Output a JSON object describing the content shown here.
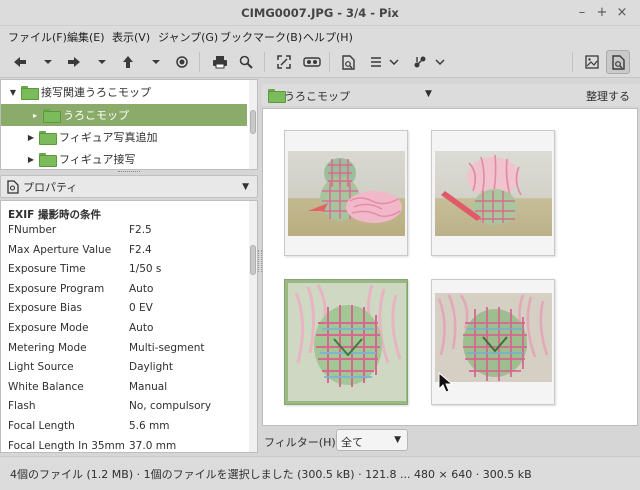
{
  "window": {
    "title": "CIMG0007.JPG - 3/4 - Pix",
    "minimize": "–",
    "maximize": "+",
    "close": "×"
  },
  "menu": [
    "ファイル(F)",
    "編集(E)",
    "表示(V)",
    "ジャンプ(G)",
    "ブックマーク(B)",
    "ヘルプ(H)"
  ],
  "tree": {
    "items": [
      {
        "label": "接写関連うろこモップ",
        "expanded": true
      },
      {
        "label": "うろこモップ",
        "selected": true
      },
      {
        "label": "フィギュア写真追加"
      },
      {
        "label": "フィギュア接写"
      }
    ]
  },
  "properties": {
    "header": "プロパティ",
    "section": "EXIF 撮影時の条件",
    "rows": [
      {
        "key": "FNumber",
        "value": "F2.5"
      },
      {
        "key": "Max Aperture Value",
        "value": "F2.4"
      },
      {
        "key": "Exposure Time",
        "value": "1/50 s"
      },
      {
        "key": "Exposure Program",
        "value": "Auto"
      },
      {
        "key": "Exposure Bias",
        "value": "0 EV"
      },
      {
        "key": "Exposure Mode",
        "value": "Auto"
      },
      {
        "key": "Metering Mode",
        "value": "Multi-segment"
      },
      {
        "key": "Light Source",
        "value": "Daylight"
      },
      {
        "key": "White Balance",
        "value": "Manual"
      },
      {
        "key": "Flash",
        "value": "No, compulsory"
      },
      {
        "key": "Focal Length",
        "value": "5.6 mm"
      },
      {
        "key": "Focal Length In 35mm F...",
        "value": "37.0 mm"
      }
    ]
  },
  "browser": {
    "location": "うろこモップ",
    "organize": "整理する",
    "filter_label": "フィルター(H):",
    "filter_value": "全て"
  },
  "status": "4個のファイル (1.2 MB) · 1個のファイルを選択しました (300.5 kB) · 121.8 ...  480 × 640 · 300.5 kB",
  "colors": {
    "accent": "#8aab6a",
    "selected_thumb": "#98b884",
    "folder": "#7cbb5c"
  }
}
